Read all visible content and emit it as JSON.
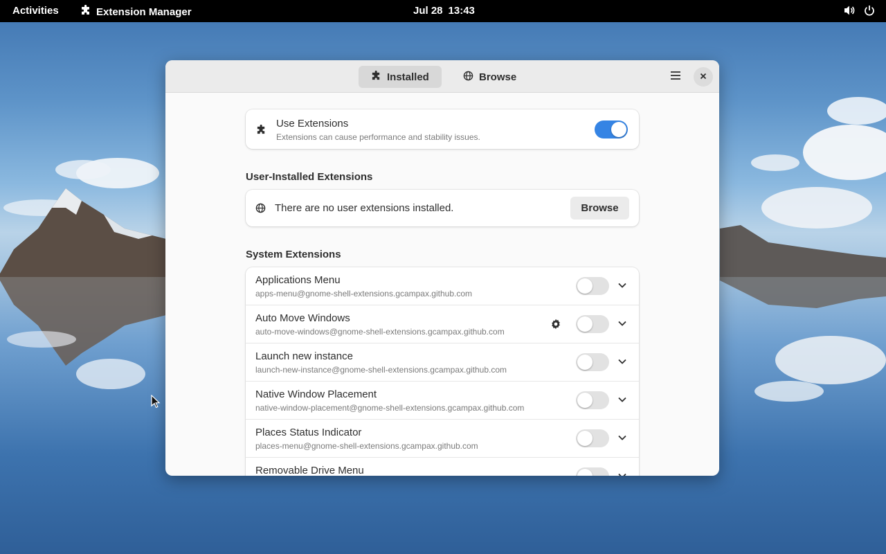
{
  "topbar": {
    "activities": "Activities",
    "app_name": "Extension Manager",
    "date": "Jul 28",
    "time": "13:43",
    "icons": [
      "puzzle-icon",
      "volume-icon",
      "power-icon"
    ]
  },
  "window": {
    "tabs": [
      {
        "label": "Installed",
        "icon": "puzzle-icon",
        "active": true
      },
      {
        "label": "Browse",
        "icon": "globe-icon",
        "active": false
      }
    ],
    "use_extensions": {
      "title": "Use Extensions",
      "subtitle": "Extensions can cause performance and stability issues.",
      "enabled": true
    },
    "user_section": {
      "heading": "User-Installed Extensions",
      "empty_text": "There are no user extensions installed.",
      "browse_label": "Browse"
    },
    "system_section": {
      "heading": "System Extensions",
      "extensions": [
        {
          "name": "Applications Menu",
          "uuid": "apps-menu@gnome-shell-extensions.gcampax.github.com",
          "enabled": false,
          "has_settings": false
        },
        {
          "name": "Auto Move Windows",
          "uuid": "auto-move-windows@gnome-shell-extensions.gcampax.github.com",
          "enabled": false,
          "has_settings": true
        },
        {
          "name": "Launch new instance",
          "uuid": "launch-new-instance@gnome-shell-extensions.gcampax.github.com",
          "enabled": false,
          "has_settings": false
        },
        {
          "name": "Native Window Placement",
          "uuid": "native-window-placement@gnome-shell-extensions.gcampax.github.com",
          "enabled": false,
          "has_settings": false
        },
        {
          "name": "Places Status Indicator",
          "uuid": "places-menu@gnome-shell-extensions.gcampax.github.com",
          "enabled": false,
          "has_settings": false
        },
        {
          "name": "Removable Drive Menu",
          "uuid": "",
          "enabled": false,
          "has_settings": false
        }
      ]
    }
  },
  "colors": {
    "accent": "#3584e4",
    "topbar": "#000000",
    "window_bg": "#fafafa",
    "headerbar": "#ebebeb"
  }
}
